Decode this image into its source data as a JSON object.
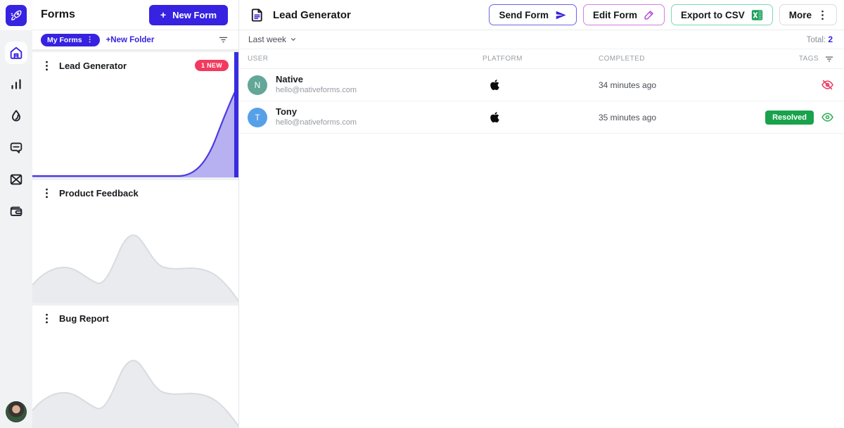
{
  "colors": {
    "accent": "#3622E0",
    "strip": "#3A2BE0",
    "badge_new": "#F23A5E",
    "resolved": "#18A24B",
    "avatar_native": "#62A797",
    "avatar_tony": "#56A0E8",
    "eye_hidden": "#EA3D62",
    "eye_visible": "#2FAE55",
    "send_border": "#6C63E8",
    "edit_border": "#D47FE2",
    "export_border": "#7ED8AD",
    "more_border": "#DCDCDC",
    "chart_purple_line": "#4B3BE0",
    "chart_purple_fill": "#B7B0F1",
    "chart_gray_line": "#D8DCE0",
    "chart_gray_fill": "#E9EBEE"
  },
  "rail": {
    "logo_icon": "rocket-icon",
    "items": [
      {
        "icon": "home-icon",
        "active": true
      },
      {
        "icon": "analytics-icon",
        "active": false
      },
      {
        "icon": "droplet-icon",
        "active": false
      },
      {
        "icon": "chat-icon",
        "active": false
      },
      {
        "icon": "mail-icon",
        "active": false
      },
      {
        "icon": "wallet-icon",
        "active": false
      }
    ]
  },
  "sidebar": {
    "title": "Forms",
    "new_form": {
      "plus": "+",
      "label": "New Form"
    },
    "my_forms_label": "My Forms",
    "my_forms_dots": "⋮",
    "new_folder_label": "+New Folder",
    "forms": [
      {
        "dots": "⋮",
        "name": "Lead Generator",
        "badge": "1 NEW",
        "selected": true,
        "chart": "purple-spike"
      },
      {
        "dots": "⋮",
        "name": "Product Feedback",
        "badge": "",
        "selected": false,
        "chart": "gray-hills"
      },
      {
        "dots": "⋮",
        "name": "Bug Report",
        "badge": "",
        "selected": false,
        "chart": "gray-hills"
      }
    ]
  },
  "main": {
    "doc_icon": "document-icon",
    "title": "Lead Generator",
    "actions": [
      {
        "label": "Send Form",
        "icon": "send-icon"
      },
      {
        "label": "Edit Form",
        "icon": "pencil-icon"
      },
      {
        "label": "Export to CSV",
        "icon": "excel-icon"
      },
      {
        "label": "More",
        "icon": "kebab-icon"
      }
    ],
    "range_label": "Last week",
    "total_label": "Total:",
    "total_value": "2",
    "table": {
      "headers": [
        "USER",
        "PLATFORM",
        "COMPLETED",
        "TAGS"
      ],
      "rows": [
        {
          "initial": "N",
          "name": "Native",
          "email": "hello@nativeforms.com",
          "platform": "apple",
          "completed": "34 minutes ago",
          "tag": "",
          "visibility": "hidden"
        },
        {
          "initial": "T",
          "name": "Tony",
          "email": "hello@nativeforms.com",
          "platform": "apple",
          "completed": "35 minutes ago",
          "tag": "Resolved",
          "visibility": "visible"
        }
      ]
    }
  }
}
